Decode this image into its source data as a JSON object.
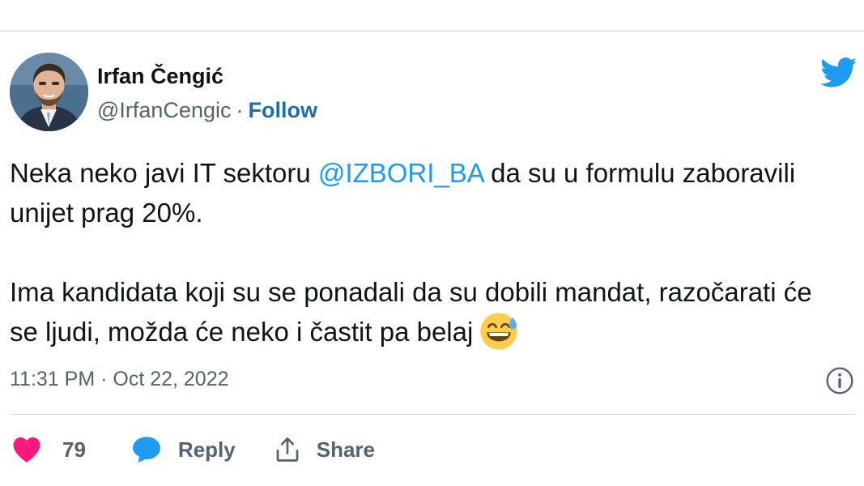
{
  "author": {
    "name": "Irfan Čengić",
    "handle": "@IrfanCengic",
    "separator": "·",
    "follow_label": "Follow"
  },
  "tweet": {
    "text_part1": "Neka neko javi IT sektoru ",
    "mention": "@IZBORI_BA",
    "text_part2": " da su u formulu zaboravili unijet prag 20%.",
    "paragraph2": "Ima kandidata koji su se ponadali da su dobili mandat, razočarati će se ljudi, možda će neko i častit pa belaj",
    "emoji": "grinning-face-with-sweat",
    "timestamp": "11:31 PM · Oct 22, 2022"
  },
  "actions": {
    "like_count": "79",
    "reply_label": "Reply",
    "share_label": "Share"
  },
  "colors": {
    "like": "#f91880",
    "reply": "#1d9bf0",
    "link": "#1d9bf0",
    "follow": "#1d6ea8",
    "twitter_blue": "#1d9bf0",
    "muted": "#536471"
  }
}
